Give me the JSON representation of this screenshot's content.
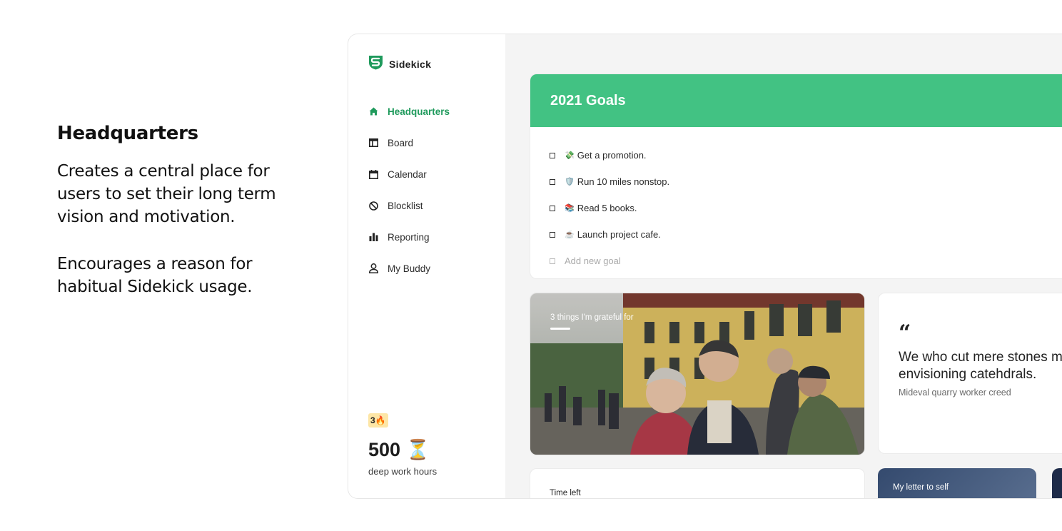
{
  "intro": {
    "heading": "Headquarters",
    "paragraph1": "Creates a central place for users to set their long term vision and motivation.",
    "paragraph2": "Encourages a reason for habitual Sidekick usage."
  },
  "brand": {
    "name": "Sidekick",
    "color": "#1f9a5c"
  },
  "nav": {
    "items": [
      {
        "label": "Headquarters",
        "icon": "home-icon",
        "active": true
      },
      {
        "label": "Board",
        "icon": "board-icon"
      },
      {
        "label": "Calendar",
        "icon": "calendar-icon"
      },
      {
        "label": "Blocklist",
        "icon": "block-icon"
      },
      {
        "label": "Reporting",
        "icon": "bar-chart-icon"
      },
      {
        "label": "My Buddy",
        "icon": "user-icon"
      }
    ]
  },
  "stats": {
    "streak": "3🔥",
    "hours": "500 ⏳",
    "hours_label": "deep work hours"
  },
  "goals": {
    "title": "2021 Goals",
    "header_color": "#42c283",
    "items": [
      {
        "emoji": "💸",
        "text": "Get a promotion."
      },
      {
        "emoji": "🛡️",
        "text": "Run 10 miles nonstop."
      },
      {
        "emoji": "📚",
        "text": "Read 5 books."
      },
      {
        "emoji": "☕",
        "text": "Launch project cafe."
      }
    ],
    "add_placeholder": "Add new goal"
  },
  "gratitude": {
    "label": "3 things I'm grateful for"
  },
  "quote": {
    "mark": "“",
    "text_line1": "We who cut mere stones must always be",
    "text_line2": "envisioning catehdrals.",
    "author": "Mideval quarry worker creed"
  },
  "time_left": {
    "label": "Time left"
  },
  "letter": {
    "label": "My letter to self"
  }
}
